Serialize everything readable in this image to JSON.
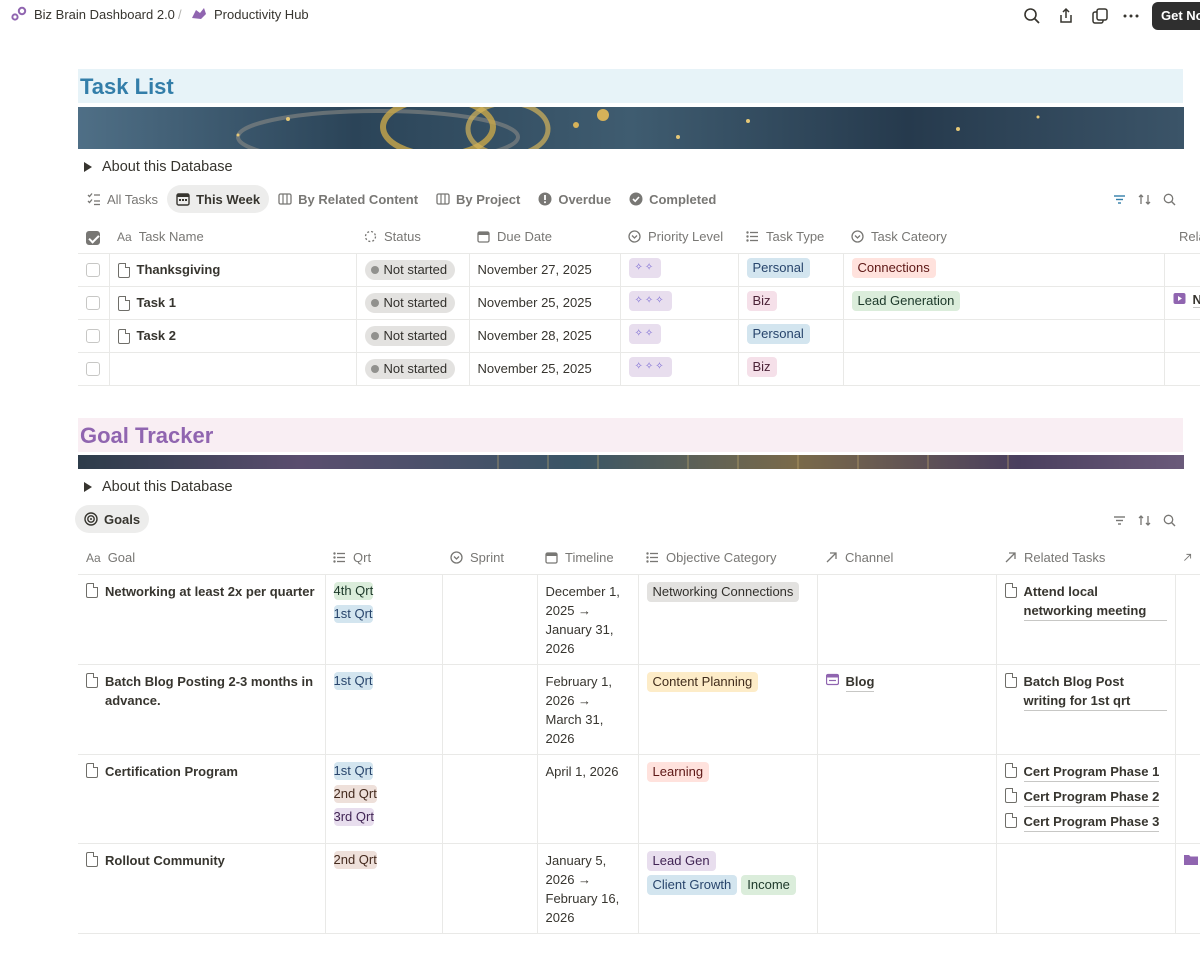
{
  "breadcrumb": {
    "workspace": "Biz Brain Dashboard 2.0",
    "page": "Productivity Hub",
    "separator": "/"
  },
  "topbar": {
    "get_now_label": "Get No"
  },
  "task_list": {
    "title": "Task List",
    "about": "About this Database",
    "tabs": [
      "All Tasks",
      "This Week",
      "By Related Content",
      "By Project",
      "Overdue",
      "Completed"
    ],
    "columns": [
      "Task Name",
      "Status",
      "Due Date",
      "Priority Level",
      "Task Type",
      "Task Cateory",
      "Related Content"
    ],
    "rows": [
      {
        "name": "Thanksgiving",
        "status": "Not started",
        "due": "November 27, 2025",
        "priority": "✧✧",
        "type": "Personal",
        "category": "Connections",
        "related": ""
      },
      {
        "name": "Task 1",
        "status": "Not started",
        "due": "November 25, 2025",
        "priority": "✧✧✧",
        "type": "Biz",
        "category": "Lead Generation",
        "related": "New YouTube Video"
      },
      {
        "name": "Task 2",
        "status": "Not started",
        "due": "November 28, 2025",
        "priority": "✧✧",
        "type": "Personal",
        "category": "",
        "related": ""
      },
      {
        "name": "",
        "status": "Not started",
        "due": "November 25, 2025",
        "priority": "✧✧✧",
        "type": "Biz",
        "category": "",
        "related": ""
      }
    ]
  },
  "goal_tracker": {
    "title": "Goal Tracker",
    "about": "About this Database",
    "tab": "Goals",
    "columns": [
      "Goal",
      "Qrt",
      "Sprint",
      "Timeline",
      "Objective Category",
      "Channel",
      "Related Tasks"
    ],
    "rows": [
      {
        "goal": "Networking at least 2x per quarter",
        "qrt": [
          "4th Qrt",
          "1st Qrt"
        ],
        "timeline": "December 1, 2025 → January 31, 2026",
        "objective": [
          "Networking Connections"
        ],
        "channel": "",
        "tasks": [
          "Attend local networking meeting"
        ]
      },
      {
        "goal": "Batch Blog Posting 2-3 months in advance.",
        "qrt": [
          "1st Qrt"
        ],
        "timeline": "February 1, 2026 → March 31, 2026",
        "objective": [
          "Content Planning"
        ],
        "channel": "Blog",
        "tasks": [
          "Batch Blog Post writing for 1st qrt"
        ]
      },
      {
        "goal": "Certification Program",
        "qrt": [
          "1st Qrt",
          "2nd Qrt",
          "3rd Qrt"
        ],
        "timeline": "April 1, 2026",
        "objective": [
          "Learning"
        ],
        "channel": "",
        "tasks": [
          "Cert Program Phase 1",
          "Cert Program Phase 2",
          "Cert Program Phase 3"
        ]
      },
      {
        "goal": "Rollout Community",
        "qrt": [
          "2nd Qrt"
        ],
        "timeline": "January 5, 2026 → February 16, 2026",
        "objective": [
          "Lead Gen",
          "Client Growth",
          "Income"
        ],
        "channel": "",
        "tasks": []
      }
    ]
  },
  "colors": {
    "task_title_bg": "#e7f3f8",
    "task_title_fg": "#337ea9",
    "goal_title_bg": "#f9eef3",
    "goal_title_fg": "#9065b0",
    "tag_personal": "#d3e5ef",
    "tag_biz": "#f5e0e9",
    "tag_connections": "#ffe2dd",
    "tag_lead_generation": "#dbeddb",
    "qrt_4th": "#dbeddb",
    "qrt_1st": "#d3e5ef",
    "qrt_2nd": "#eee0da",
    "qrt_3rd": "#e8deee"
  }
}
